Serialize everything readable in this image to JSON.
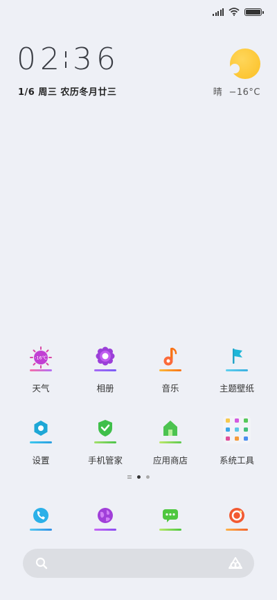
{
  "status_bar": {
    "signal_icon": "signal-icon",
    "wifi_icon": "wifi-icon",
    "battery_icon": "battery-icon"
  },
  "clock": {
    "hour": "02",
    "minute": "36"
  },
  "date": "1/6 周三 农历冬月廿三",
  "weather": {
    "icon": "sunny-cloud-icon",
    "condition": "晴",
    "temp": "−16°C"
  },
  "apps_row1": [
    {
      "label": "天气",
      "icon": "weather-icon",
      "badge": "-16℃"
    },
    {
      "label": "相册",
      "icon": "gallery-icon"
    },
    {
      "label": "音乐",
      "icon": "music-icon"
    },
    {
      "label": "主题壁纸",
      "icon": "themes-icon"
    }
  ],
  "apps_row2": [
    {
      "label": "设置",
      "icon": "settings-icon"
    },
    {
      "label": "手机管家",
      "icon": "security-icon"
    },
    {
      "label": "应用商店",
      "icon": "app-store-icon"
    },
    {
      "label": "系统工具",
      "icon": "tools-folder-icon"
    }
  ],
  "page_indicator": {
    "pages": 2,
    "current": 1
  },
  "dock": [
    {
      "icon": "phone-icon"
    },
    {
      "icon": "browser-icon"
    },
    {
      "icon": "messages-icon"
    },
    {
      "icon": "camera-icon"
    }
  ],
  "search": {
    "search_icon": "search-icon",
    "assistant_icon": "assistant-icon"
  }
}
